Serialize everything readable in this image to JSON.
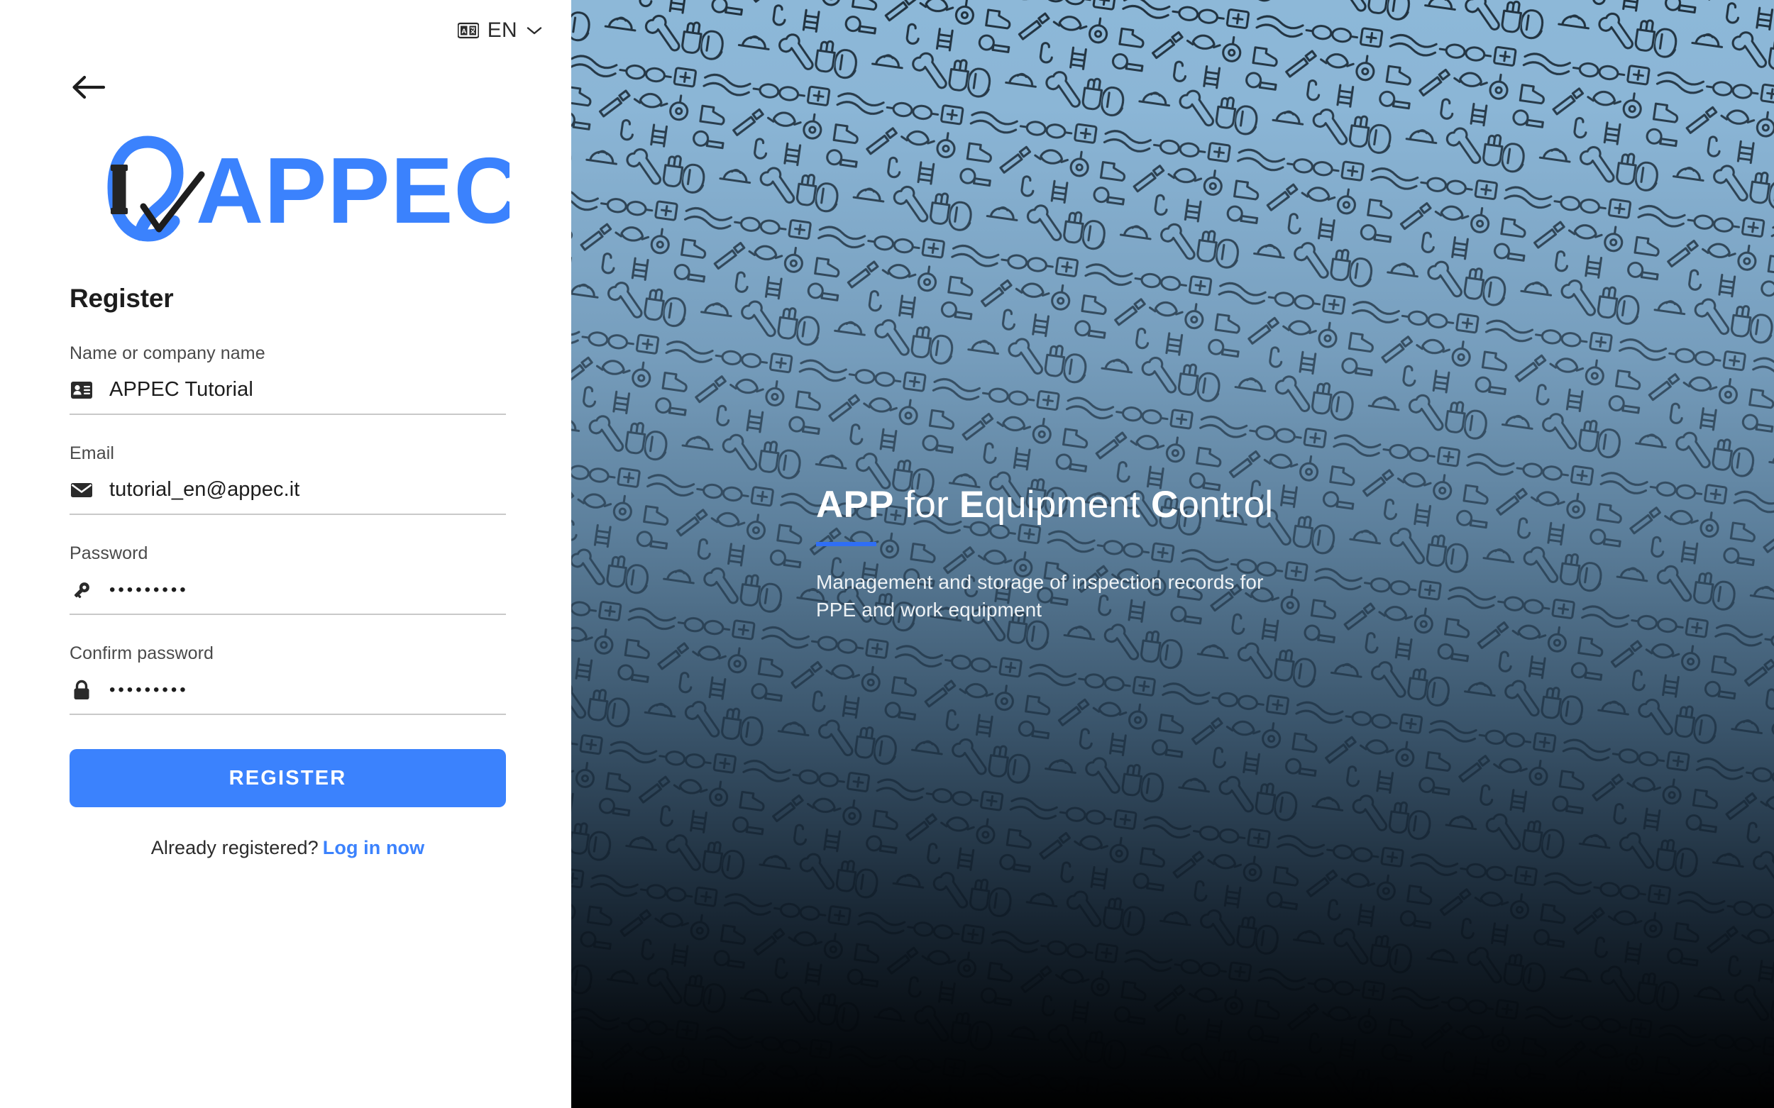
{
  "language_selector": {
    "icon": "translate-icon",
    "code": "EN",
    "chevron": "chevron-down-icon"
  },
  "back_button": {
    "icon": "arrow-left-icon"
  },
  "logo": {
    "alt": "APPEC",
    "wordmark": "APPEC",
    "brand_color": "#3b82fd"
  },
  "form": {
    "title": "Register",
    "fields": [
      {
        "label": "Name or company name",
        "icon": "contact-card-icon",
        "value": "APPEC Tutorial",
        "masked": false,
        "placeholder": "Name or company name"
      },
      {
        "label": "Email",
        "icon": "envelope-icon",
        "value": "tutorial_en@appec.it",
        "masked": false,
        "placeholder": "Email"
      },
      {
        "label": "Password",
        "icon": "key-icon",
        "value": "•••••••••",
        "masked": true,
        "placeholder": "Password"
      },
      {
        "label": "Confirm password",
        "icon": "lock-icon",
        "value": "•••••••••",
        "masked": true,
        "placeholder": "Confirm password"
      }
    ],
    "submit_label": "REGISTER",
    "footer_prompt": "Already registered?",
    "footer_link": "Log in now"
  },
  "hero": {
    "title_part_1": "APP",
    "title_part_2": " for ",
    "title_part_3": "E",
    "title_part_4": "quipment ",
    "title_part_5": "C",
    "title_part_6": "ontrol",
    "subtitle": "Management and storage of inspection records for PPE and work equipment",
    "accent_color": "#2f6ef5"
  },
  "colors": {
    "brand_blue": "#3b82fd",
    "accent_blue": "#2f6ef5",
    "panel_top": "#8db8d8",
    "panel_mid": "#4a6478",
    "panel_bottom": "#000000",
    "text_dark": "#1d1d1d",
    "label_gray": "#4a4a4a",
    "field_underline": "#c9c9c9"
  }
}
